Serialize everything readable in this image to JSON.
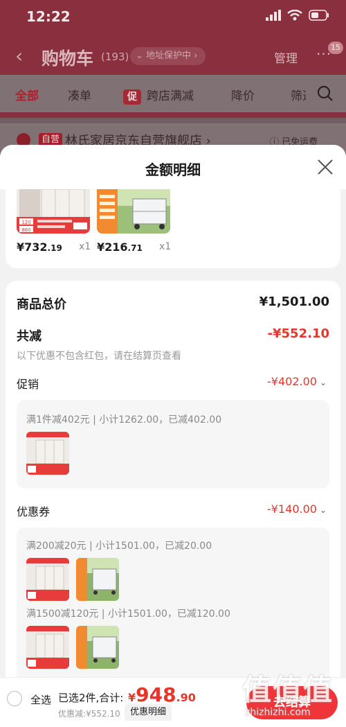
{
  "status_bar": {
    "time": "12:22"
  },
  "nav": {
    "back": "‹",
    "title": "购物车",
    "count": "(193)",
    "address_protect": "⌄ 地址保护中 ›",
    "manage": "管理",
    "more": "···",
    "more_badge": "15"
  },
  "tabs": [
    {
      "label": "全部"
    },
    {
      "label": "凑单"
    },
    {
      "badge": "促",
      "label": "跨店满减"
    },
    {
      "label": "降价"
    },
    {
      "label": "筛选"
    }
  ],
  "store": {
    "tag": "自营",
    "name": "林氏家居京东自营旗舰店 ›",
    "shipping": "ⓘ 已免运费"
  },
  "sheet": {
    "title": "金额明细",
    "products": [
      {
        "price_int": "¥732",
        "price_dec": ".19",
        "qty": "x1",
        "img_badge": "860",
        "img_badge2": "120"
      },
      {
        "price_int": "¥216",
        "price_dec": ".71",
        "qty": "x1"
      }
    ],
    "total_label": "商品总价",
    "total_value": "¥1,501.00",
    "reduce_label": "共减",
    "reduce_value": "-¥552.10",
    "reduce_note": "以下优惠不包含红包，请在结算页查看",
    "promotion": {
      "label": "促销",
      "value": "-¥402.00",
      "rule": "满1件减402元 | 小计1262.00，已减402.00"
    },
    "coupon": {
      "label": "优惠券",
      "value": "-¥140.00",
      "rule1": "满200减20元 | 小计1501.00，已减20.00",
      "rule2": "满1500减120元 | 小计1501.00，已减120.00"
    }
  },
  "bottom": {
    "select_all": "全选",
    "selected": "已选2件,合计:",
    "total_currency": "¥",
    "total_int": "948",
    "total_dec": ".90",
    "discount": "优惠减:¥552.10",
    "detail_link": "优惠明细",
    "checkout": "去结算"
  },
  "watermark": {
    "main": "值值值",
    "site": "zhizhizhi.com"
  },
  "colors": {
    "accent": "#e5362c",
    "checkout": "#f0353a",
    "overlay_bg": "#8a2f3e"
  }
}
